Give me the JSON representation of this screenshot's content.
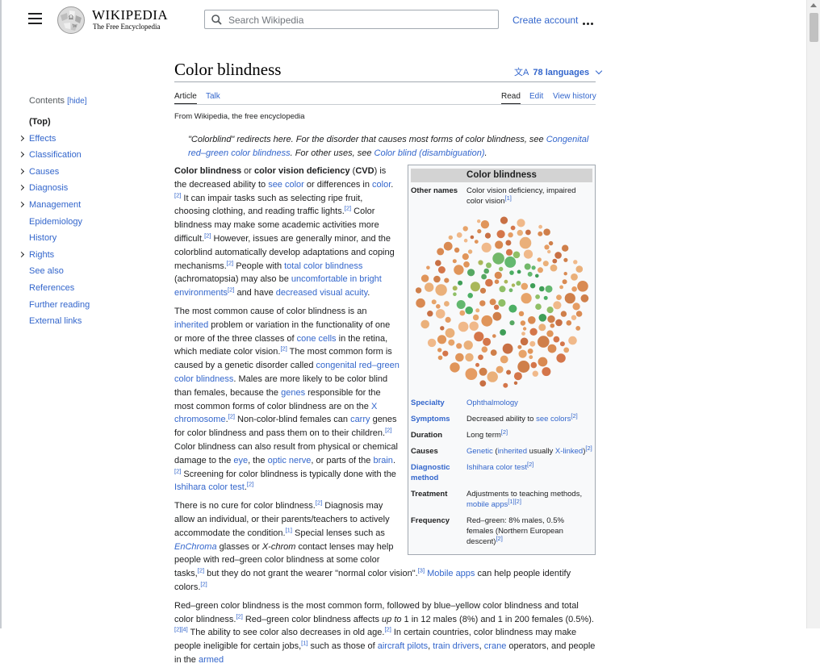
{
  "header": {
    "logo_title": "WIKIPEDIA",
    "logo_tagline": "The Free Encyclopedia",
    "search_placeholder": "Search Wikipedia",
    "create_account": "Create account"
  },
  "page": {
    "title": "Color blindness",
    "languages": "78 languages",
    "tabs": {
      "article": "Article",
      "talk": "Talk",
      "read": "Read",
      "edit": "Edit",
      "history": "View history"
    },
    "from_wiki": "From Wikipedia, the free encyclopedia"
  },
  "toc": {
    "title": "Contents",
    "hide": "[hide]",
    "items": [
      {
        "label": "(Top)",
        "expandable": false
      },
      {
        "label": "Effects",
        "expandable": true
      },
      {
        "label": "Classification",
        "expandable": true
      },
      {
        "label": "Causes",
        "expandable": true
      },
      {
        "label": "Diagnosis",
        "expandable": true
      },
      {
        "label": "Management",
        "expandable": true
      },
      {
        "label": "Epidemiology",
        "expandable": false
      },
      {
        "label": "History",
        "expandable": false
      },
      {
        "label": "Rights",
        "expandable": true
      },
      {
        "label": "See also",
        "expandable": false
      },
      {
        "label": "References",
        "expandable": false
      },
      {
        "label": "Further reading",
        "expandable": false
      },
      {
        "label": "External links",
        "expandable": false
      }
    ]
  },
  "hatnote": {
    "t1": "\"Colorblind\" redirects here. For the disorder that causes most forms of color blindness, see ",
    "l1": "Congenital red–green color blindness",
    "t2": ". For other uses, see ",
    "l2": "Color blind (disambiguation)",
    "t3": "."
  },
  "infobox": {
    "title": "Color blindness",
    "other_names_label": "Other names",
    "other_names": "Color vision deficiency, impaired color vision",
    "specialty_label": "Specialty",
    "specialty": "Ophthalmology",
    "symptoms_label": "Symptoms",
    "symptoms_text": "Decreased ability to ",
    "symptoms_link": "see colors",
    "duration_label": "Duration",
    "duration": "Long term",
    "causes_label": "Causes",
    "causes_link1": "Genetic",
    "causes_t1": " (",
    "causes_link2": "inherited",
    "causes_t2": " usually ",
    "causes_link3": "X-linked",
    "causes_t3": ")",
    "diagnostic_label": "Diagnostic method",
    "diagnostic": "Ishihara color test",
    "treatment_label": "Treatment",
    "treatment_text": "Adjustments to teaching methods, ",
    "treatment_link": "mobile apps",
    "frequency_label": "Frequency",
    "frequency": "Red–green: 8% males, 0.5% females (Northern European descent)",
    "colors": {
      "orange": "#e0955a",
      "green": "#4caf64",
      "olive": "#a9b75a"
    }
  },
  "body": {
    "p1": {
      "b1": "Color blindness",
      "t1": " or ",
      "b2": "color vision deficiency",
      "t2": " (",
      "b3": "CVD",
      "t3": ") is the decreased ability to ",
      "l1": "see color",
      "t4": " or differences in ",
      "l2": "color",
      "t5": " It can impair tasks such as selecting ripe fruit, choosing clothing, and reading traffic lights.",
      "t6": " Color blindness may make some academic activities more difficult.",
      "t7": " However, issues are generally minor, and the colorblind automatically develop adaptations and coping mechanisms.",
      "t8": " People with ",
      "l3": "total color blindness",
      "t9": " (achromatopsia) may also be ",
      "l4": "uncomfortable in bright environments",
      "t10": " and have ",
      "l5": "decreased visual acuity",
      "t11": "."
    },
    "p2": {
      "t1": "The most common cause of color blindness is an ",
      "l1": "inherited",
      "t2": " problem or variation in the functionality of one or more of the three classes of ",
      "l2": "cone cells",
      "t3": " in the retina, which mediate color vision.",
      "t4": " The most common form is caused by a genetic disorder called ",
      "l3": "congenital red–green color blindness",
      "t5": ". Males are more likely to be color blind than females, because the ",
      "l4": "genes",
      "t6": " responsible for the most common forms of color blindness are on the ",
      "l5": "X chromosome",
      "t7": ".",
      "t8": " Non-color-blind females can ",
      "l6": "carry",
      "t9": " genes for color blindness and pass them on to their children.",
      "t10": " Color blindness can also result from physical or chemical damage to the ",
      "l7": "eye",
      "t11": ", the ",
      "l8": "optic nerve",
      "t12": ", or parts of the ",
      "l9": "brain",
      "t13": ".",
      "t14": " Screening for color blindness is typically done with the ",
      "l10": "Ishihara color test",
      "t15": "."
    },
    "p3": {
      "t1": "There is no cure for color blindness.",
      "t2": " Diagnosis may allow an individual, or their parents/teachers to actively accommodate the condition.",
      "t3": " Special lenses such as ",
      "l1": "EnChroma",
      "t4": " glasses or ",
      "i1": "X-chrom",
      "t5": " contact lenses may help people with red–green color blindness at some color tasks,",
      "t6": " but they do not grant the wearer \"normal color vision\".",
      "l2": "Mobile apps",
      "t7": " can help people identify colors."
    },
    "p4": {
      "t1": "Red–green color blindness is the most common form, followed by blue–yellow color blindness and total color blindness.",
      "t2": " Red–green color blindness affects ",
      "i1": "up to",
      "t3": " 1 in 12 males (8%) and 1 in 200 females (0.5%).",
      "t4": " The ability to see color also decreases in old age.",
      "t5": " In certain countries, color blindness may make people ineligible for certain jobs,",
      "t6": " such as those of ",
      "l1": "aircraft pilots",
      "t7": ", ",
      "l2": "train drivers",
      "t8": ", ",
      "l3": "crane",
      "t9": " operators, and people in the ",
      "l4": "armed"
    }
  }
}
